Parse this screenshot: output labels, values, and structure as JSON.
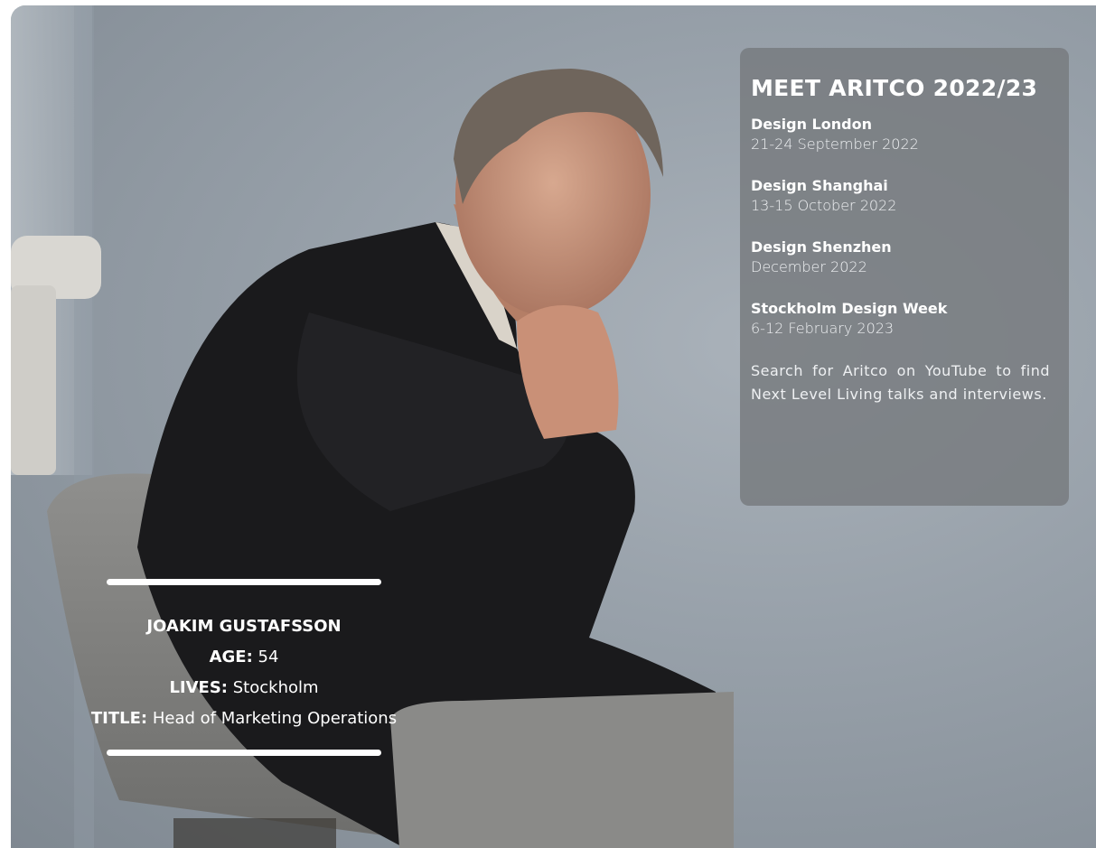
{
  "events_panel": {
    "heading": "MEET ARITCO 2022/23",
    "events": [
      {
        "name": "Design London",
        "date": "21-24 September 2022"
      },
      {
        "name": "Design Shanghai",
        "date": "13-15 October 2022"
      },
      {
        "name": "Design Shenzhen",
        "date": "December 2022"
      },
      {
        "name": "Stockholm Design Week",
        "date": "6-12 February 2023"
      }
    ],
    "note": "Search for Aritco on YouTube to find Next Level Living talks and interviews."
  },
  "profile": {
    "name": "JOAKIM GUSTAFSSON",
    "age_label": "AGE:",
    "age_value": "54",
    "lives_label": "LIVES:",
    "lives_value": "Stockholm",
    "title_label": "TITLE:",
    "title_value": "Head of Marketing Operations"
  }
}
